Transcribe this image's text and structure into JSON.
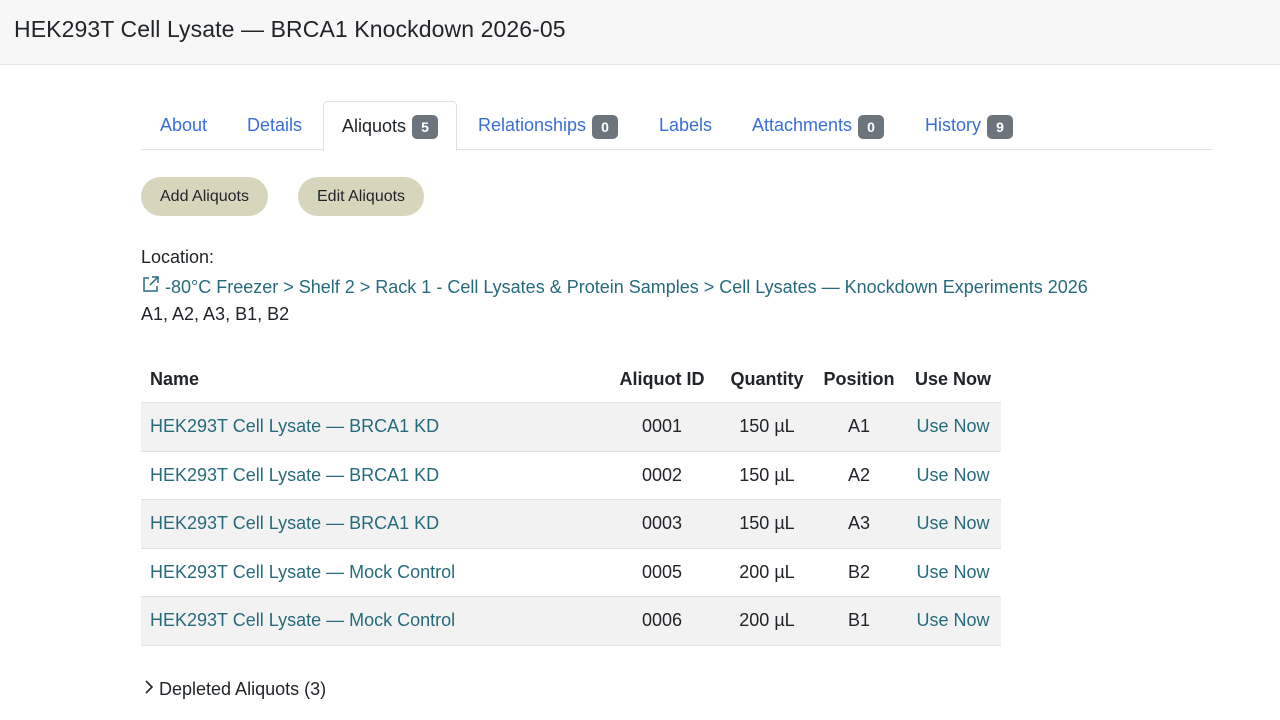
{
  "page_title": "HEK293T Cell Lysate — BRCA1 Knockdown 2026-05",
  "tabs": [
    {
      "label": "About"
    },
    {
      "label": "Details"
    },
    {
      "label": "Aliquots",
      "count": "5"
    },
    {
      "label": "Relationships",
      "count": "0"
    },
    {
      "label": "Labels"
    },
    {
      "label": "Attachments",
      "count": "0"
    },
    {
      "label": "History",
      "count": "9"
    }
  ],
  "active_tab": "Aliquots",
  "actions": {
    "add": "Add Aliquots",
    "edit": "Edit Aliquots"
  },
  "location": {
    "label": "Location:",
    "path": "-80°C Freezer > Shelf 2 > Rack 1 - Cell Lysates & Protein Samples > Cell Lysates — Knockdown Experiments 2026",
    "positions": "A1, A2, A3, B1, B2"
  },
  "table": {
    "headers": [
      "Name",
      "Aliquot ID",
      "Quantity",
      "Position",
      "Use Now"
    ],
    "rows": [
      {
        "name": "HEK293T Cell Lysate — BRCA1 KD",
        "id": "0001",
        "qty": "150 µL",
        "pos": "A1",
        "action": "Use Now"
      },
      {
        "name": "HEK293T Cell Lysate — BRCA1 KD",
        "id": "0002",
        "qty": "150 µL",
        "pos": "A2",
        "action": "Use Now"
      },
      {
        "name": "HEK293T Cell Lysate — BRCA1 KD",
        "id": "0003",
        "qty": "150 µL",
        "pos": "A3",
        "action": "Use Now"
      },
      {
        "name": "HEK293T Cell Lysate — Mock Control",
        "id": "0005",
        "qty": "200 µL",
        "pos": "B2",
        "action": "Use Now"
      },
      {
        "name": "HEK293T Cell Lysate — Mock Control",
        "id": "0006",
        "qty": "200 µL",
        "pos": "B1",
        "action": "Use Now"
      }
    ]
  },
  "depleted": {
    "label": "Depleted Aliquots (3)"
  },
  "colors": {
    "link": "#266b7c",
    "tab_link": "#3b6fd6",
    "badge": "#6c757d",
    "button": "#d7d6bd"
  },
  "icons": {
    "location": "external-link-icon",
    "depleted": "chevron-right-icon"
  }
}
